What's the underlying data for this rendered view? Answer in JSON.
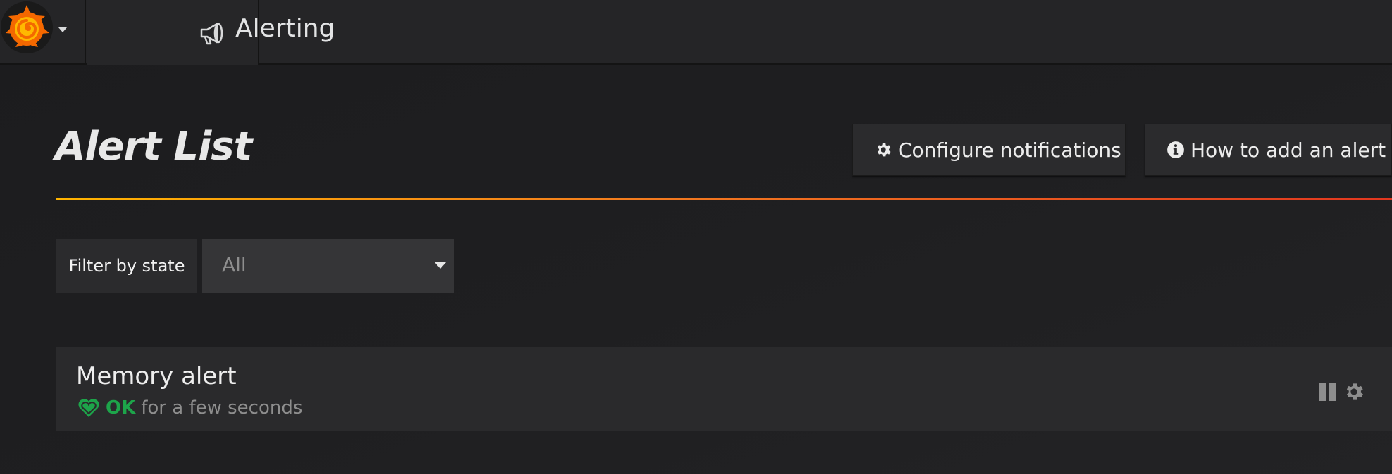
{
  "topnav": {
    "section_title": "Alerting",
    "icons": {
      "logo": "grafana-logo",
      "menu": "caret-down-icon",
      "section": "megaphone-icon"
    },
    "colors": {
      "logo_orange": "#f46800",
      "logo_yellow": "#ffb800"
    }
  },
  "header": {
    "title": "Alert List",
    "buttons": [
      {
        "label": "Configure notifications",
        "icon": "gear-icon"
      },
      {
        "label": "How to add an alert",
        "icon": "info-icon"
      }
    ],
    "accent_rule_colors": [
      "#ffb400",
      "#f37a1f",
      "#e2371f"
    ]
  },
  "filter": {
    "label": "Filter by state",
    "selected": "All"
  },
  "alerts": [
    {
      "name": "Memory alert",
      "state": "OK",
      "since": "for a few seconds",
      "state_color": "#1da44a",
      "state_icon": "heart-icon",
      "actions": [
        "pause-icon",
        "gear-icon"
      ]
    }
  ]
}
